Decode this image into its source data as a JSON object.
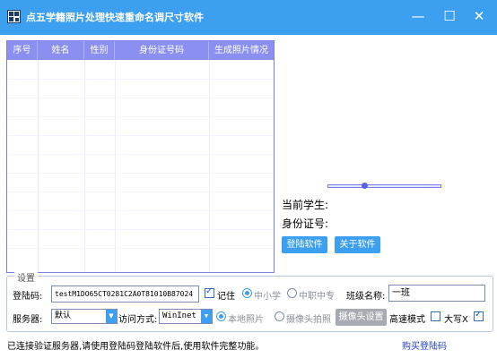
{
  "window": {
    "title": "点五学籍照片处理快速重命名调尺寸软件",
    "minimize_glyph": "—",
    "maximize_glyph": "☐",
    "close_glyph": "✕"
  },
  "grid": {
    "columns": [
      "序号",
      "姓名",
      "性别",
      "身份证号码",
      "生成照片情况"
    ],
    "rows": []
  },
  "preview": {
    "slider_fraction": 0.31,
    "current_student_label": "当前学生:",
    "id_number_label": "身份证号:",
    "login_button": "登陆软件",
    "about_button": "关于软件"
  },
  "settings": {
    "legend": "设置",
    "login_code_label": "登陆码:",
    "login_code_value": "testM1DO65CT0281C2A0T81010B87024",
    "remember_label": "记住",
    "remember_checked": true,
    "school_level_options": [
      "中小学",
      "中职中专"
    ],
    "school_level_selected": "中小学",
    "class_name_label": "班级名称:",
    "class_name_value": "一班",
    "server_label": "服务器:",
    "server_value": "默认",
    "access_mode_label": "访问方式:",
    "access_mode_value": "WinInet",
    "source_options": [
      "本地照片",
      "摄像头拍照"
    ],
    "source_selected": "本地照片",
    "camera_settings_button": "摄像头设置",
    "high_speed_label": "高速模式",
    "high_speed_checked": false,
    "uppercase_x_label": "大写X",
    "uppercase_x_checked": true
  },
  "status_bar": {
    "message": "已连接验证服务器,请使用登陆码登陆软件后,使用软件完整功能。",
    "buy_link": "购买登陆码"
  },
  "colors": {
    "titlebar": "#3c9ff0",
    "grid_header": "#8b90f0",
    "accent_button": "#3c9ff0",
    "disabled_button": "#a8abb1",
    "link": "#1f3fbf"
  }
}
